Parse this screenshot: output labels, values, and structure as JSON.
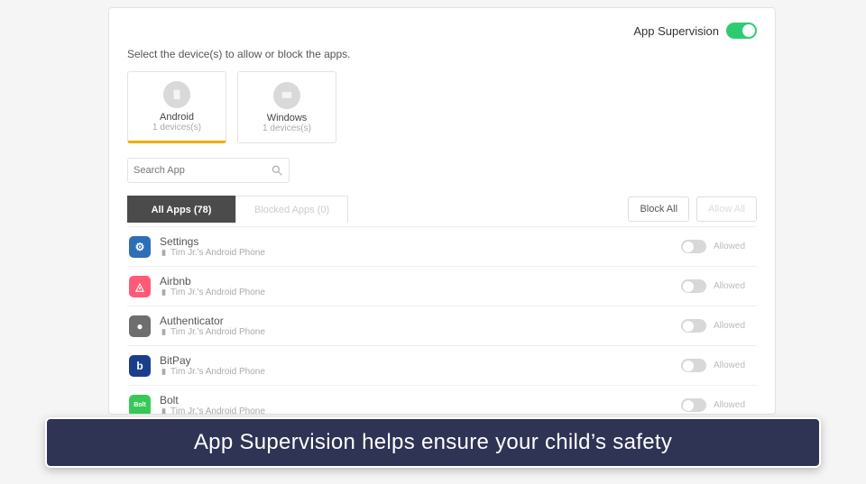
{
  "header": {
    "title": "App Supervision",
    "master_toggle_on": true
  },
  "instruction": "Select the device(s) to allow or block the apps.",
  "devices": [
    {
      "name": "Android",
      "count": "1 devices(s)",
      "selected": true
    },
    {
      "name": "Windows",
      "count": "1 devices(s)",
      "selected": false
    }
  ],
  "search": {
    "placeholder": "Search App"
  },
  "tabs": {
    "all_label": "All Apps (78)",
    "blocked_label": "Blocked Apps (0)"
  },
  "bulk": {
    "block_all": "Block All",
    "allow_all": "Allow All"
  },
  "apps": [
    {
      "name": "Settings",
      "sub": "Tim Jr.'s Android Phone",
      "status": "Allowed",
      "icon_bg": "#2d6fb6",
      "icon_text": "⚙"
    },
    {
      "name": "Airbnb",
      "sub": "Tim Jr.'s Android Phone",
      "status": "Allowed",
      "icon_bg": "#ff5a78",
      "icon_text": "◬"
    },
    {
      "name": "Authenticator",
      "sub": "Tim Jr.'s Android Phone",
      "status": "Allowed",
      "icon_bg": "#6e6e6e",
      "icon_text": "●"
    },
    {
      "name": "BitPay",
      "sub": "Tim Jr.'s Android Phone",
      "status": "Allowed",
      "icon_bg": "#1a3e8c",
      "icon_text": "b"
    },
    {
      "name": "Bolt",
      "sub": "Tim Jr.'s Android Phone",
      "status": "Allowed",
      "icon_bg": "#37c957",
      "icon_text": "Bolt"
    }
  ],
  "caption": "App Supervision helps ensure your child’s safety"
}
